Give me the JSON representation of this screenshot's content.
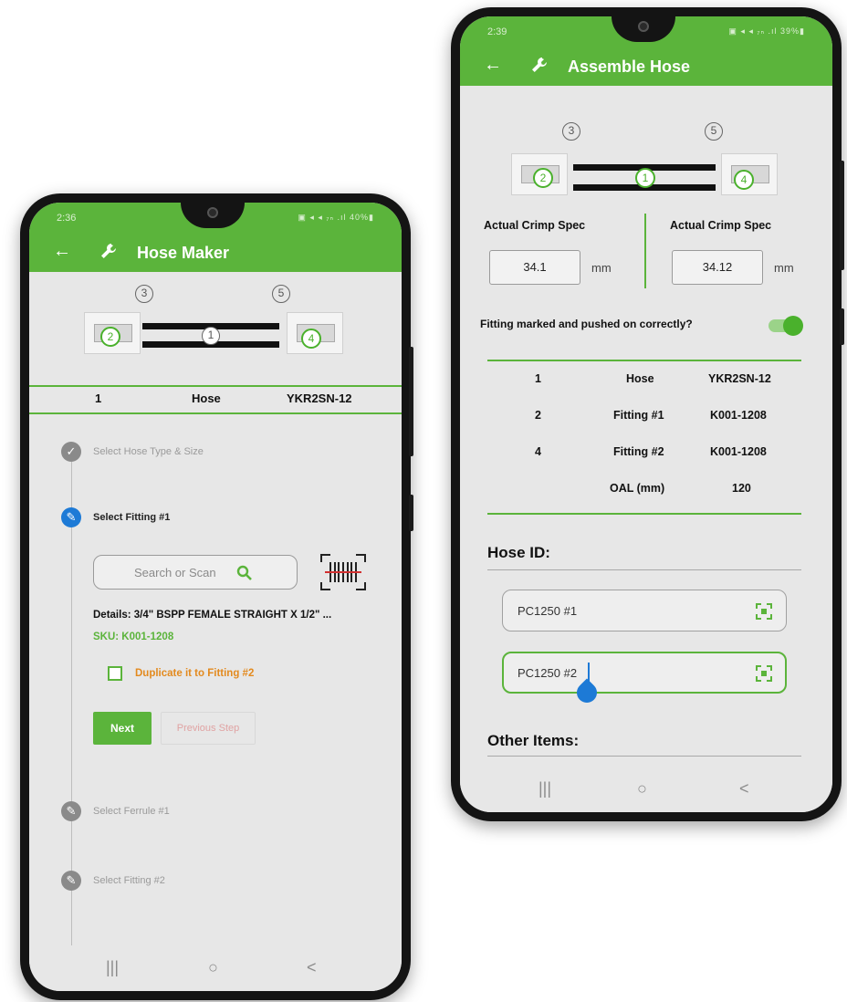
{
  "left_phone": {
    "status": {
      "time": "2:36",
      "icons": "▣ ◂ ◂ ₇ₙ .ıl 40%▮"
    },
    "app_bar": {
      "back": "←",
      "title": "Hose Maker"
    },
    "diagram": {
      "top_left_num": "3",
      "top_right_num": "5",
      "fit_left_num": "2",
      "center_num": "1",
      "fit_right_num": "4"
    },
    "summary_row": {
      "col1": "1",
      "col2": "Hose",
      "col3": "YKR2SN-12"
    },
    "steps": [
      {
        "label": "Select Hose Type & Size",
        "icon": "✓"
      },
      {
        "label": "Select Fitting #1",
        "icon": "✎"
      },
      {
        "label": "Select Ferrule #1",
        "icon": "✎"
      },
      {
        "label": "Select Fitting #2",
        "icon": "✎"
      }
    ],
    "search": {
      "placeholder": "Search or Scan",
      "icon": "search-icon"
    },
    "details": "Details: 3/4\" BSPP FEMALE STRAIGHT X 1/2\" ...",
    "sku": "SKU: K001-1208",
    "duplicate_label": "Duplicate it to Fitting #2",
    "next_button": "Next",
    "previous_button": "Previous Step",
    "nav": {
      "recent": "|||",
      "home": "○",
      "back": "<"
    }
  },
  "right_phone": {
    "status": {
      "time": "2:39",
      "icons": "▣ ◂ ◂ ₇ₙ .ıl 39%▮"
    },
    "app_bar": {
      "back": "←",
      "title": "Assemble Hose"
    },
    "diagram": {
      "top_left_num": "3",
      "top_right_num": "5",
      "fit_left_num": "2",
      "center_num": "1",
      "fit_right_num": "4"
    },
    "crimp": {
      "left_label": "Actual Crimp Spec",
      "left_value": "34.1",
      "left_unit": "mm",
      "right_label": "Actual Crimp Spec",
      "right_value": "34.12",
      "right_unit": "mm"
    },
    "fitting_question": "Fitting marked and pushed on correctly?",
    "toggle_on": true,
    "table": [
      {
        "c1": "1",
        "c2": "Hose",
        "c3": "YKR2SN-12"
      },
      {
        "c1": "2",
        "c2": "Fitting #1",
        "c3": "K001-1208"
      },
      {
        "c1": "4",
        "c2": "Fitting #2",
        "c3": "K001-1208"
      },
      {
        "c1": "",
        "c2": "OAL (mm)",
        "c3": "120"
      }
    ],
    "hose_id_heading": "Hose ID:",
    "hose_id_1": "PC1250 #1",
    "hose_id_2": "PC1250 #2",
    "other_items_heading": "Other Items:",
    "nav": {
      "recent": "|||",
      "home": "○",
      "back": "<"
    }
  },
  "colors": {
    "brand_green": "#5bb43b",
    "active_blue": "#1d7ad6",
    "orange": "#e38a1e"
  }
}
